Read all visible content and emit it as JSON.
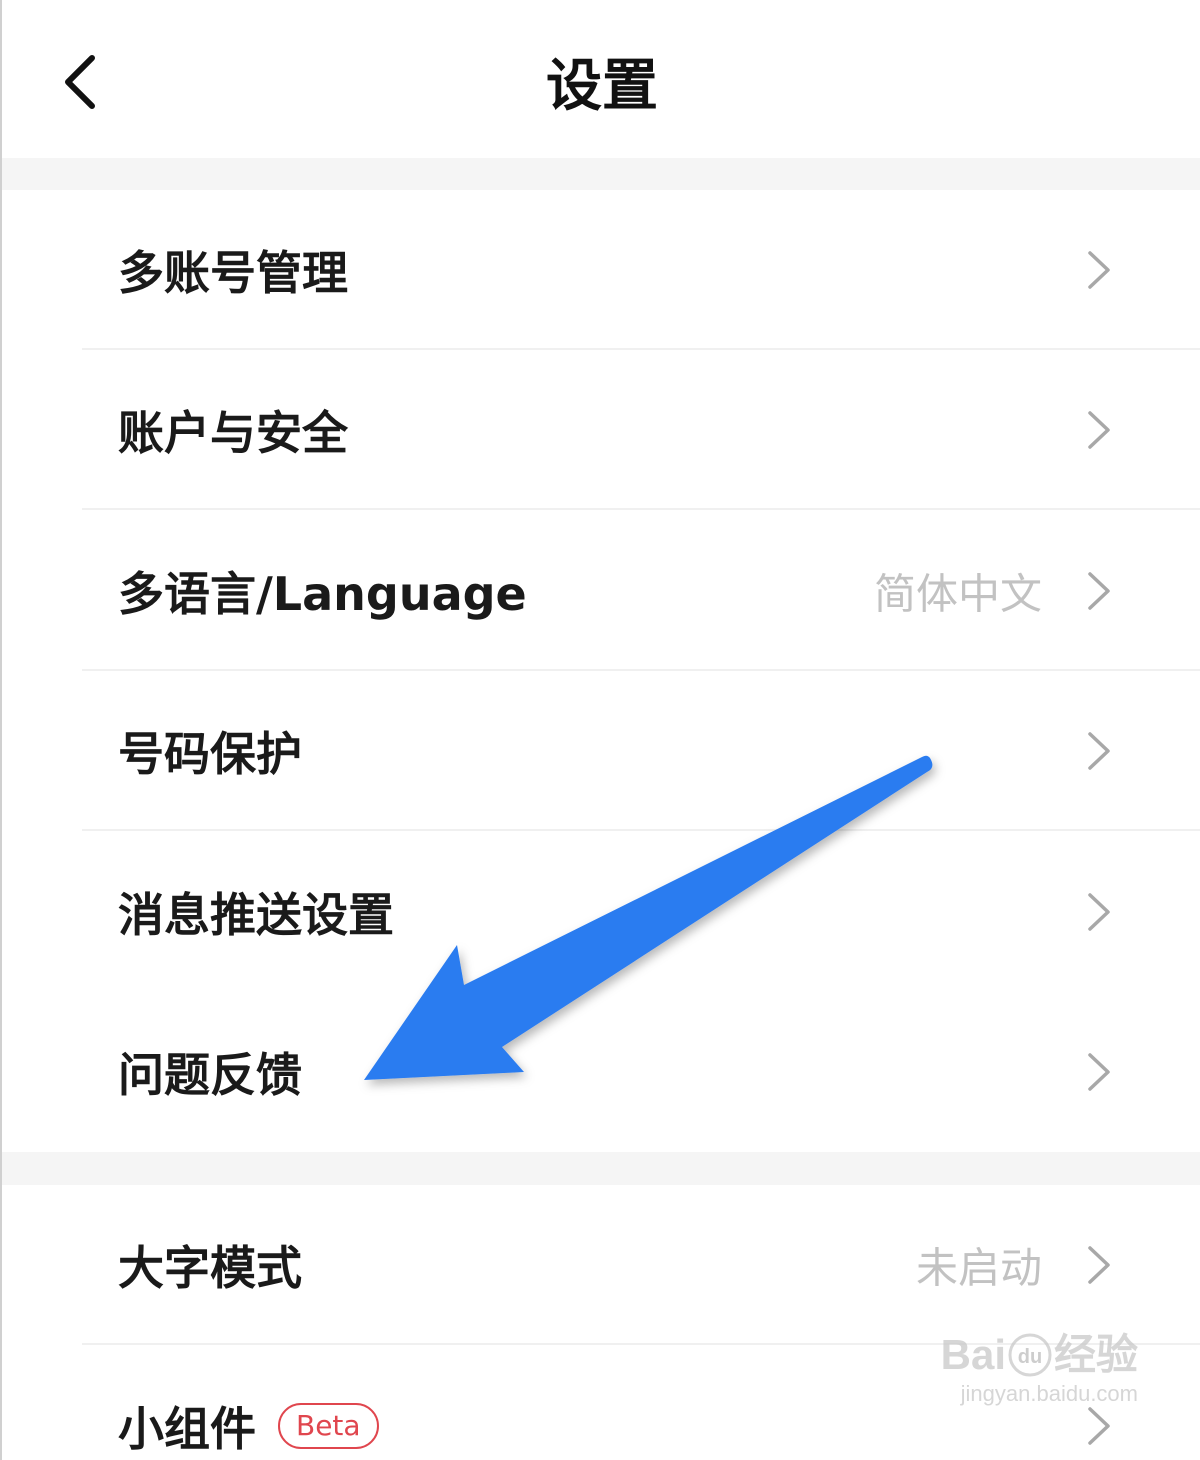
{
  "header": {
    "title": "设置",
    "back_icon": "chevron-left-icon"
  },
  "settings": {
    "items": [
      {
        "label": "多账号管理"
      },
      {
        "label": "账户与安全"
      },
      {
        "label": "多语言/Language",
        "value": "简体中文"
      },
      {
        "label": "号码保护"
      },
      {
        "label": "消息推送设置"
      },
      {
        "label": "问题反馈"
      },
      {
        "label": "大字模式",
        "value": "未启动"
      },
      {
        "label": "小组件",
        "badge": "Beta"
      }
    ]
  },
  "annotation": {
    "arrow_color": "#2a7bf0",
    "points_to": "问题反馈"
  },
  "watermark": {
    "brand": "Bai",
    "brand_tail": "经验",
    "paw_text": "du",
    "url": "jingyan.baidu.com"
  },
  "colors": {
    "section_gap": "#f5f5f5",
    "badge": "#e0464e",
    "value_text": "#c2c2c2"
  }
}
